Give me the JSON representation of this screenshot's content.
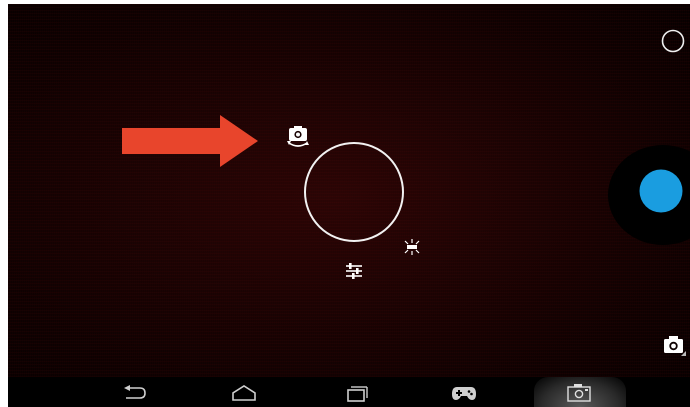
{
  "app": {
    "name": ""
  },
  "colors": {
    "shutter": "#1a9de0",
    "annotation_arrow": "#e8452c",
    "viewfinder": "#1a0303",
    "icon": "#ffffff"
  },
  "viewfinder": {
    "icons": {
      "switch_camera": "switch-camera-icon",
      "focus_ring": "focus-ring-icon",
      "settings": "settings-sliders-icon",
      "flash": "flash-icon",
      "mode_selector": "mode-circle-icon",
      "shutter": "shutter-button",
      "thumbnail": "last-photo-camera-icon"
    }
  },
  "annotation": {
    "arrow": "red-arrow-pointing-right"
  },
  "navbar": {
    "items": [
      {
        "name": "back",
        "icon": "back-icon"
      },
      {
        "name": "home",
        "icon": "home-icon"
      },
      {
        "name": "recent_apps",
        "icon": "recent-apps-icon"
      },
      {
        "name": "game",
        "icon": "gamepad-icon"
      },
      {
        "name": "screenshot",
        "icon": "screenshot-icon",
        "active": true
      }
    ]
  }
}
